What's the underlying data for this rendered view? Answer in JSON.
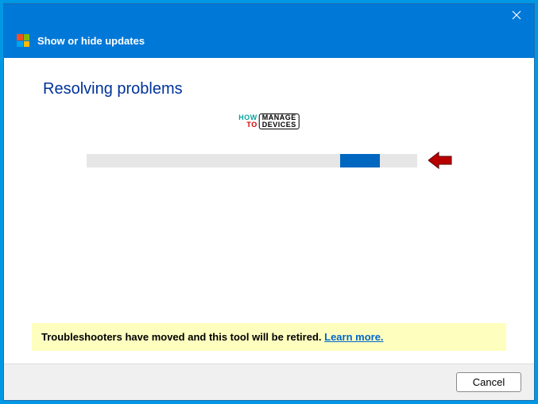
{
  "titlebar": {
    "title": "Show or hide updates"
  },
  "content": {
    "heading": "Resolving problems"
  },
  "watermark": {
    "how": "HOW",
    "to": "TO",
    "manage": "MANAGE",
    "devices": "DEVICES"
  },
  "notice": {
    "text": "Troubleshooters have moved and this tool will be retired. ",
    "link_label": "Learn more."
  },
  "footer": {
    "cancel_label": "Cancel"
  }
}
